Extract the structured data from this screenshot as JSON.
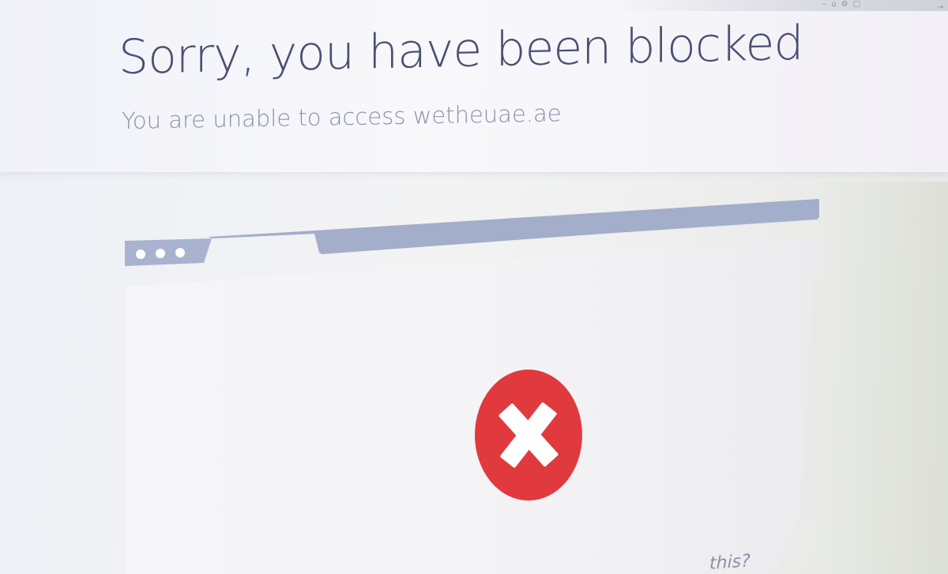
{
  "header": {
    "title": "Sorry, you have been blocked",
    "subtitle": "You are unable to access wetheuae.ae"
  },
  "top_strip": {
    "icons": [
      "lock-icon",
      "bookmark-icon",
      "extension-icon",
      "tab-icon",
      "arrow-icon"
    ]
  },
  "illustration": {
    "window_dots": 3,
    "status_icon": "error-x-icon",
    "colors": {
      "frame": "#a9b3cf",
      "window_body": "#f4f4f6",
      "error_red": "#e13a3e",
      "dots": "#ffffff"
    }
  },
  "footer": {
    "partial_text": "this?"
  }
}
